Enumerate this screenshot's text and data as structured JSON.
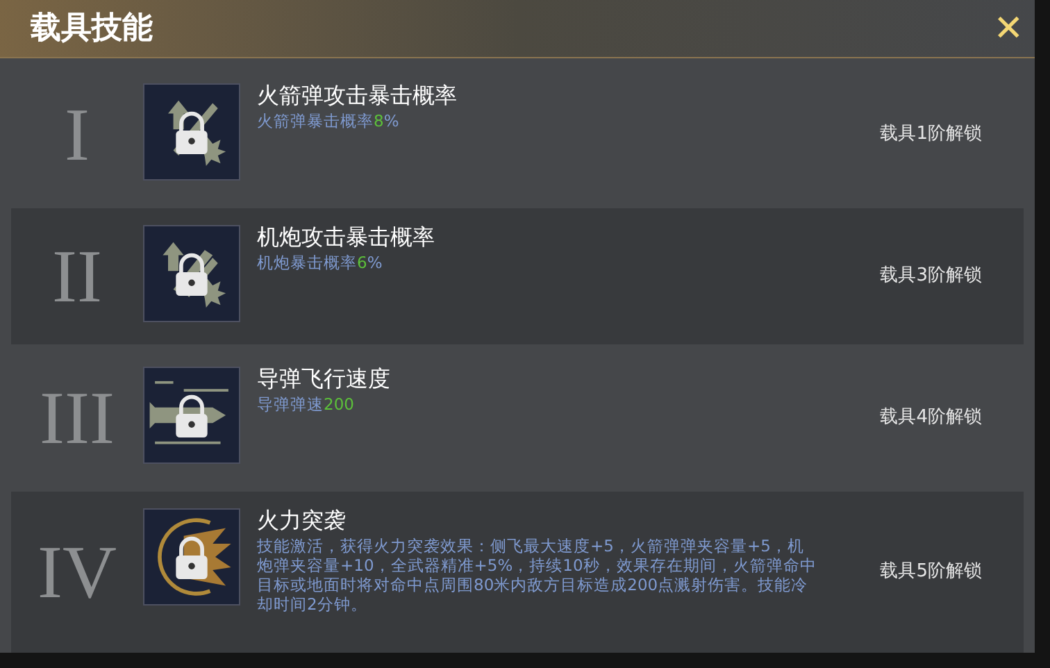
{
  "dialog": {
    "title": "载具技能",
    "close_label": "✕"
  },
  "skills": [
    {
      "numeral": "I",
      "kind": "rocket",
      "locked": true,
      "name": "火箭弹攻击暴击概率",
      "description": [
        {
          "text": "火箭弹暴击概率",
          "highlight": false
        },
        {
          "text": "8",
          "highlight": true
        },
        {
          "text": "%",
          "highlight": false
        }
      ],
      "unlock": "载具1阶解锁"
    },
    {
      "numeral": "II",
      "kind": "cannon",
      "locked": true,
      "name": "机炮攻击暴击概率",
      "description": [
        {
          "text": "机炮暴击概率",
          "highlight": false
        },
        {
          "text": "6",
          "highlight": true
        },
        {
          "text": "%",
          "highlight": false
        }
      ],
      "unlock": "载具3阶解锁"
    },
    {
      "numeral": "III",
      "kind": "missile",
      "locked": true,
      "name": "导弹飞行速度",
      "description": [
        {
          "text": "导弹弹速",
          "highlight": false
        },
        {
          "text": "200",
          "highlight": true
        }
      ],
      "unlock": "载具4阶解锁"
    },
    {
      "numeral": "IV",
      "kind": "burst",
      "locked": true,
      "name": "火力突袭",
      "description": [
        {
          "text": "技能激活，获得火力突袭效果：侧飞最大速度+5，火箭弹弹夹容量+5，机炮弹夹容量+10，全武器精准+5%，持续10秒，效果存在期间，火箭弹命中目标或地面时将对命中点周围80米内敌方目标造成200点溅射伤害。技能冷却时间2分钟。",
          "highlight": false
        }
      ],
      "unlock": "载具5阶解锁"
    }
  ]
}
